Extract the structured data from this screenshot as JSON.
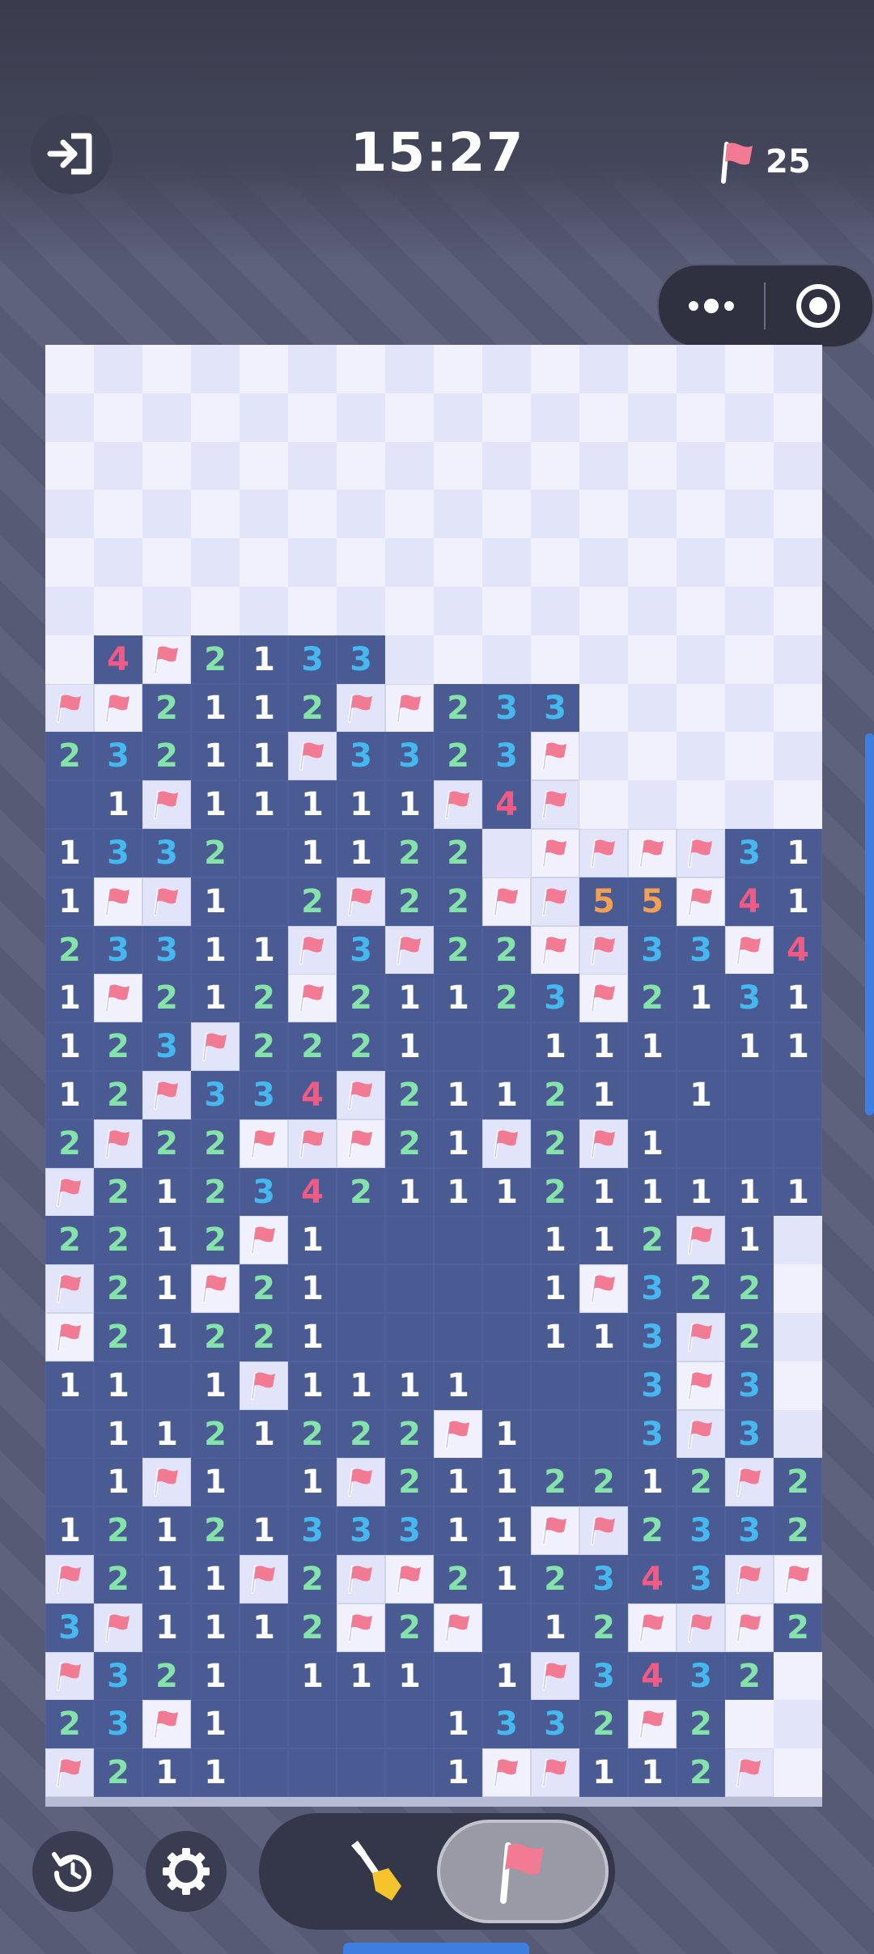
{
  "header": {
    "timer": "15:27",
    "flags_remaining": "25"
  },
  "icons": {
    "exit": "exit-icon",
    "menu": "more-dots-icon",
    "record": "target-icon",
    "restart": "restart-icon",
    "settings": "gear-icon",
    "dig": "shovel-icon",
    "flag": "flag-icon"
  },
  "colors": {
    "open_cell": "#4a5a92",
    "covered_light": "#f0f1fd",
    "covered_dark": "#e2e4fa",
    "flag": "#f27a93",
    "num1": "#ffffff",
    "num2": "#84e3a8",
    "num3": "#45b8ef",
    "num4": "#f25a83",
    "num5": "#f3a052"
  },
  "board": {
    "cols": 16,
    "rows": 30,
    "legend": "# covered, F flagged, . empty open, 1-5 number",
    "grid": [
      "################",
      "################",
      "################",
      "################",
      "################",
      "################",
      "#4F2133#########",
      "FF2112FF233#####",
      "23211F3323F#####",
      ".1F11111F4F#####",
      "1332.1122#FFFF31",
      "1FF1.2F22FF55F41",
      "23311F3F22FF33F4F",
      "1F212F21123F2131F",
      "123F2221..111.11",
      "12F334F21121.1...",
      "2F22FFF21F2F1...",
      "F212342111211111",
      "2212F1....112F1",
      "F21F21....1F322",
      "F21221....113F2",
      "11.1F1111...3F3",
      ".1121222F1..3F3",
      ".1F1.1F2112212F2",
      "1212133311FF2332",
      "F211F2FF212343FF2",
      "3F1112F2F.12FFF2",
      "F321.111.1F3432",
      "23F1....1332F2",
      "F211....1FF112F"
    ]
  }
}
